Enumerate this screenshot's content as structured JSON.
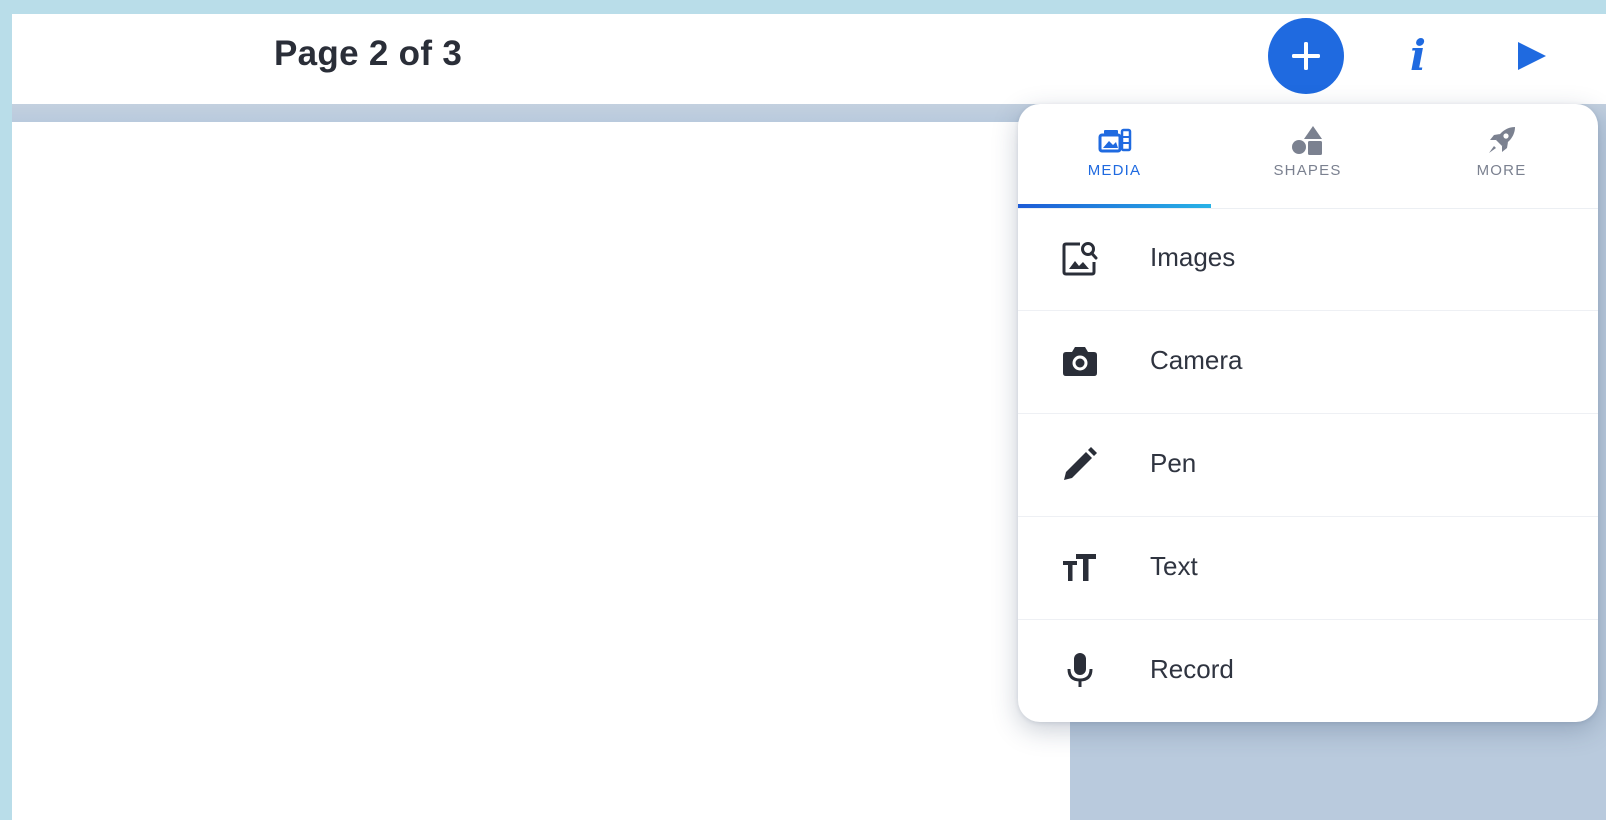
{
  "header": {
    "page_indicator": "Page 2 of 3",
    "add_button_glyph": "+",
    "info_button_glyph": "i"
  },
  "popup": {
    "tabs": [
      {
        "label": "MEDIA",
        "icon": "media-icon",
        "active": true
      },
      {
        "label": "SHAPES",
        "icon": "shapes-icon",
        "active": false
      },
      {
        "label": "MORE",
        "icon": "rocket-icon",
        "active": false
      }
    ],
    "items": [
      {
        "label": "Images",
        "icon": "image-search-icon"
      },
      {
        "label": "Camera",
        "icon": "camera-icon"
      },
      {
        "label": "Pen",
        "icon": "pen-icon"
      },
      {
        "label": "Text",
        "icon": "text-size-icon"
      },
      {
        "label": "Record",
        "icon": "microphone-icon"
      }
    ]
  },
  "colors": {
    "accent": "#1f6ae0",
    "frame": "#b9dde9",
    "workspace": "#b9cadd",
    "icon_dark": "#2a2e38"
  }
}
